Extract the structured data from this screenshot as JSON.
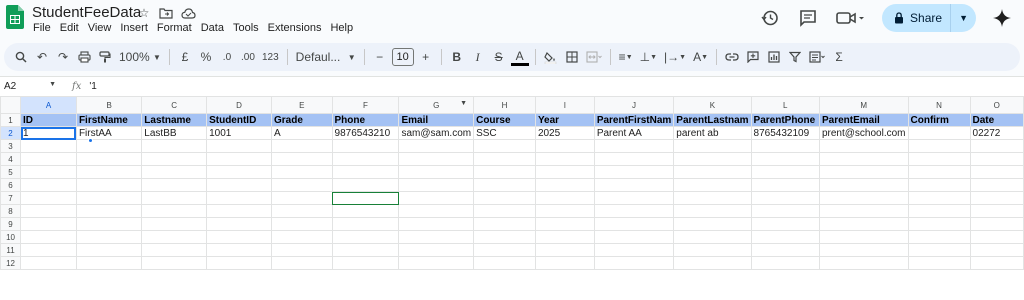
{
  "app": {
    "title": "StudentFeeData",
    "menu": [
      "File",
      "Edit",
      "View",
      "Insert",
      "Format",
      "Data",
      "Tools",
      "Extensions",
      "Help"
    ],
    "share_label": "Share",
    "brand_color": "#0f9d58",
    "accent_color": "#c2e7ff"
  },
  "toolbar": {
    "zoom": "100%",
    "currency": "£",
    "percent": "%",
    "dec_decrease": ".0",
    "dec_increase": ".00",
    "number_format": "123",
    "font": "Defaul...",
    "font_size": "10"
  },
  "formula_bar": {
    "cell_ref": "A2",
    "fx": "fx",
    "value": "'1"
  },
  "sheet": {
    "columns": [
      "A",
      "B",
      "C",
      "D",
      "E",
      "F",
      "G",
      "H",
      "I",
      "J",
      "K",
      "L",
      "M",
      "N",
      "O"
    ],
    "rows": [
      "1",
      "2",
      "3",
      "4",
      "5",
      "6",
      "7",
      "8",
      "9",
      "10",
      "11",
      "12"
    ],
    "header": [
      "ID",
      "FirstName",
      "Lastname",
      "StudentID",
      "Grade",
      "Phone",
      "Email",
      "Course",
      "Year",
      "ParentFirstNam",
      "ParentLastnam",
      "ParentPhone",
      "ParentEmail",
      "Confirm",
      "Date"
    ],
    "data": [
      "1",
      "FirstAA",
      "LastBB",
      "1001",
      "A",
      "9876543210",
      "sam@sam.com",
      "SSC",
      "2025",
      "Parent AA",
      "parent ab",
      "8765432109",
      "prent@school.com",
      "",
      "02272"
    ],
    "header_fill": "#a4c2f4"
  }
}
